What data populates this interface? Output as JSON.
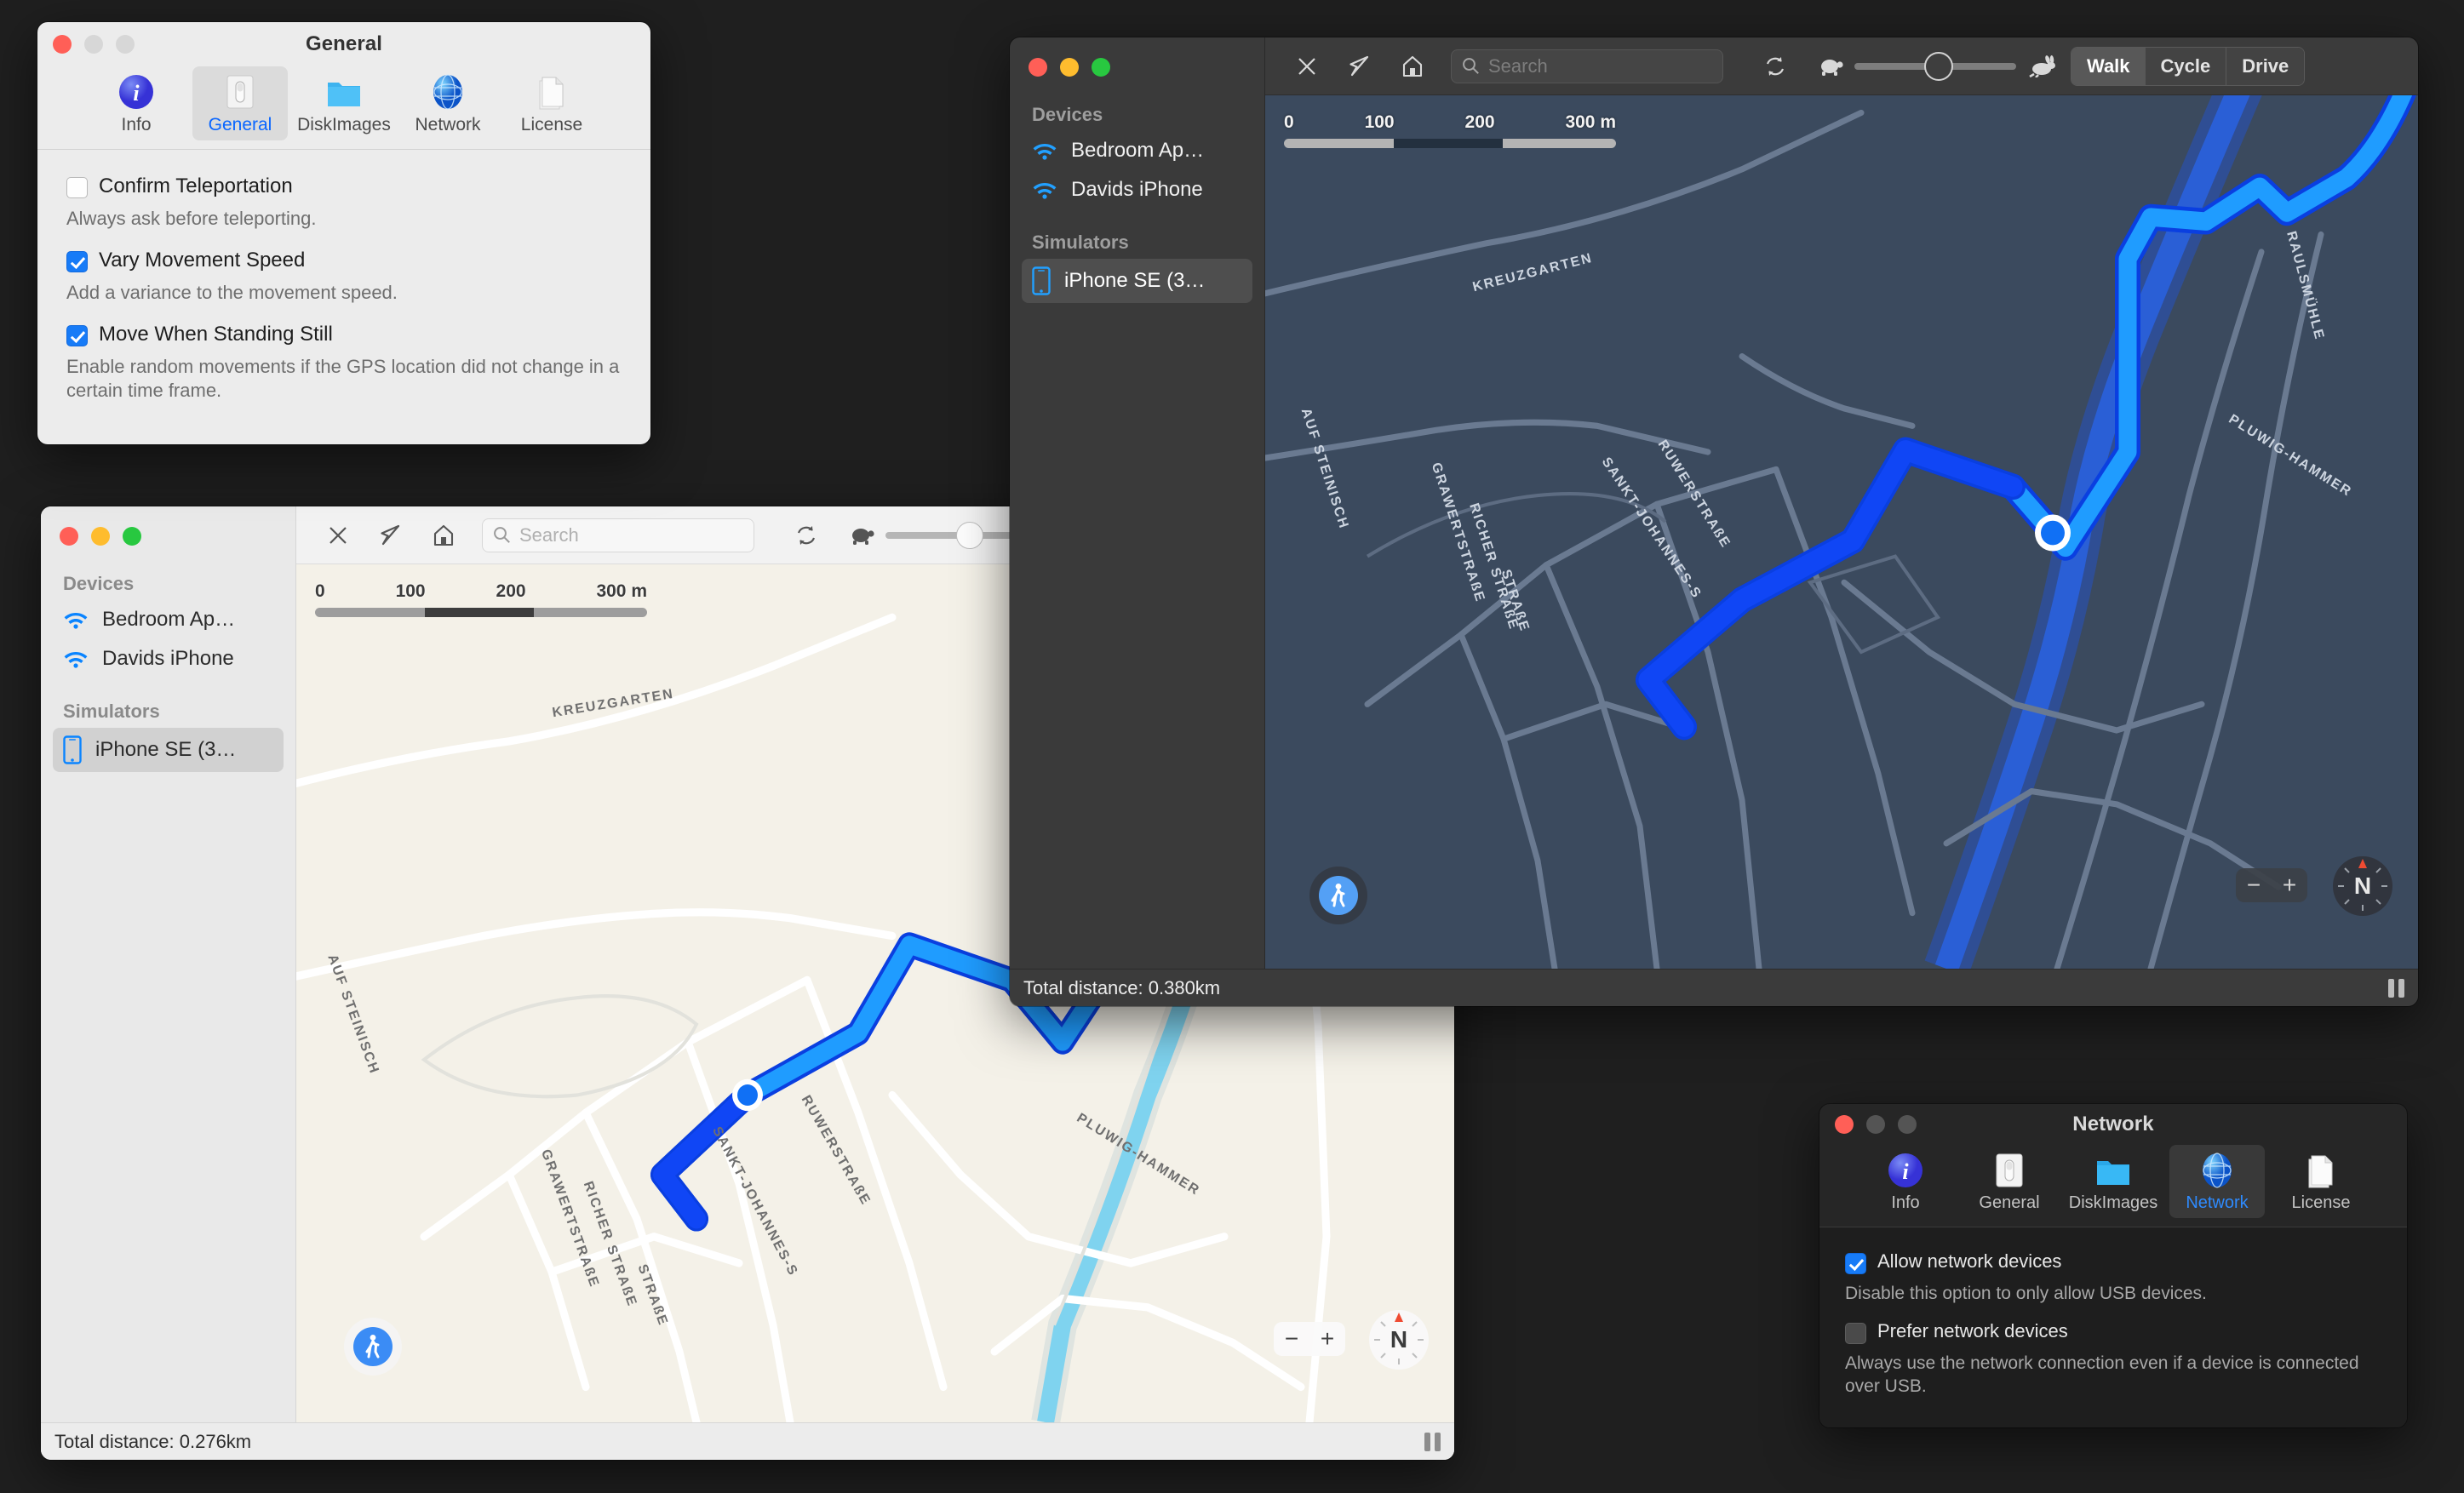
{
  "general_window": {
    "title": "General",
    "tabs": [
      {
        "label": "Info",
        "icon": "info-icon",
        "selected": false
      },
      {
        "label": "General",
        "icon": "switch-icon",
        "selected": true
      },
      {
        "label": "DiskImages",
        "icon": "folder-icon",
        "selected": false
      },
      {
        "label": "Network",
        "icon": "globe-icon",
        "selected": false
      },
      {
        "label": "License",
        "icon": "document-icon",
        "selected": false
      }
    ],
    "options": [
      {
        "label": "Confirm Teleportation",
        "checked": false,
        "description": "Always ask before teleporting."
      },
      {
        "label": "Vary Movement Speed",
        "checked": true,
        "description": "Add a variance to the movement speed."
      },
      {
        "label": "Move When Standing Still",
        "checked": true,
        "description": "Enable random movements if the GPS location did not change in a certain time frame."
      }
    ]
  },
  "network_window": {
    "title": "Network",
    "tabs": [
      {
        "label": "Info",
        "icon": "info-icon",
        "selected": false
      },
      {
        "label": "General",
        "icon": "switch-icon",
        "selected": false
      },
      {
        "label": "DiskImages",
        "icon": "folder-icon",
        "selected": false
      },
      {
        "label": "Network",
        "icon": "globe-icon",
        "selected": true
      },
      {
        "label": "License",
        "icon": "document-icon",
        "selected": false
      }
    ],
    "options": [
      {
        "label": "Allow network devices",
        "checked": true,
        "description": "Disable this option to only allow USB devices."
      },
      {
        "label": "Prefer network devices",
        "checked": false,
        "description": "Always use the network connection even if a device is connected over USB."
      }
    ]
  },
  "sidebar": {
    "sections": [
      {
        "header": "Devices",
        "items": [
          {
            "label": "Bedroom Ap…",
            "icon": "wifi-icon",
            "selected": false
          },
          {
            "label": "Davids iPhone",
            "icon": "wifi-icon",
            "selected": false
          }
        ]
      },
      {
        "header": "Simulators",
        "items": [
          {
            "label": "iPhone SE (3…",
            "icon": "iphone-icon",
            "selected": true
          }
        ]
      }
    ]
  },
  "toolbar": {
    "close_icon": "close-icon",
    "locate_icon": "navigation-arrow-icon",
    "home_icon": "home-icon",
    "search_placeholder": "Search",
    "refresh_icon": "refresh-icon",
    "slow_icon": "turtle-icon",
    "fast_icon": "rabbit-icon",
    "speed_slider_value": 52,
    "modes": [
      {
        "label": "Walk",
        "selected": true
      },
      {
        "label": "Cycle",
        "selected": false
      },
      {
        "label": "Drive",
        "selected": false
      }
    ]
  },
  "map_scale": {
    "ticks": [
      "0",
      "100",
      "200",
      "300 m"
    ]
  },
  "map_controls": {
    "pin_icon": "walking-person-icon",
    "zoom_out": "−",
    "zoom_in": "+",
    "compass_label": "N",
    "pause_icon": "pause-icon"
  },
  "dark_map_window": {
    "status": "Total distance: 0.380km",
    "street_labels": [
      "KREUZGARTEN",
      "RAULSMÜHLE",
      "AUF STEINISCH",
      "PLUWIG-HAMMER",
      "GRAWERTSTRAßE",
      "RICHER STRAßE",
      "STRAßE",
      "SANKT-JOHANNES-S",
      "RUWERSTRAßE"
    ]
  },
  "light_map_window": {
    "status": "Total distance: 0.276km",
    "street_labels": [
      "KREUZGARTEN",
      "AUF STEINISCH",
      "PLUWIG-HAMMER",
      "GRAWERTSTRAßE",
      "RICHER STRAßE",
      "STRAßE",
      "SANKT-JOHANNES-S",
      "RUWERSTRAßE"
    ]
  },
  "colors": {
    "accent_blue": "#177bf7",
    "route_blue": "#1060ff",
    "route_light_blue": "#1f9cff",
    "dark_map_bg": "#3b4a5e",
    "light_map_bg": "#f4f1e8"
  }
}
